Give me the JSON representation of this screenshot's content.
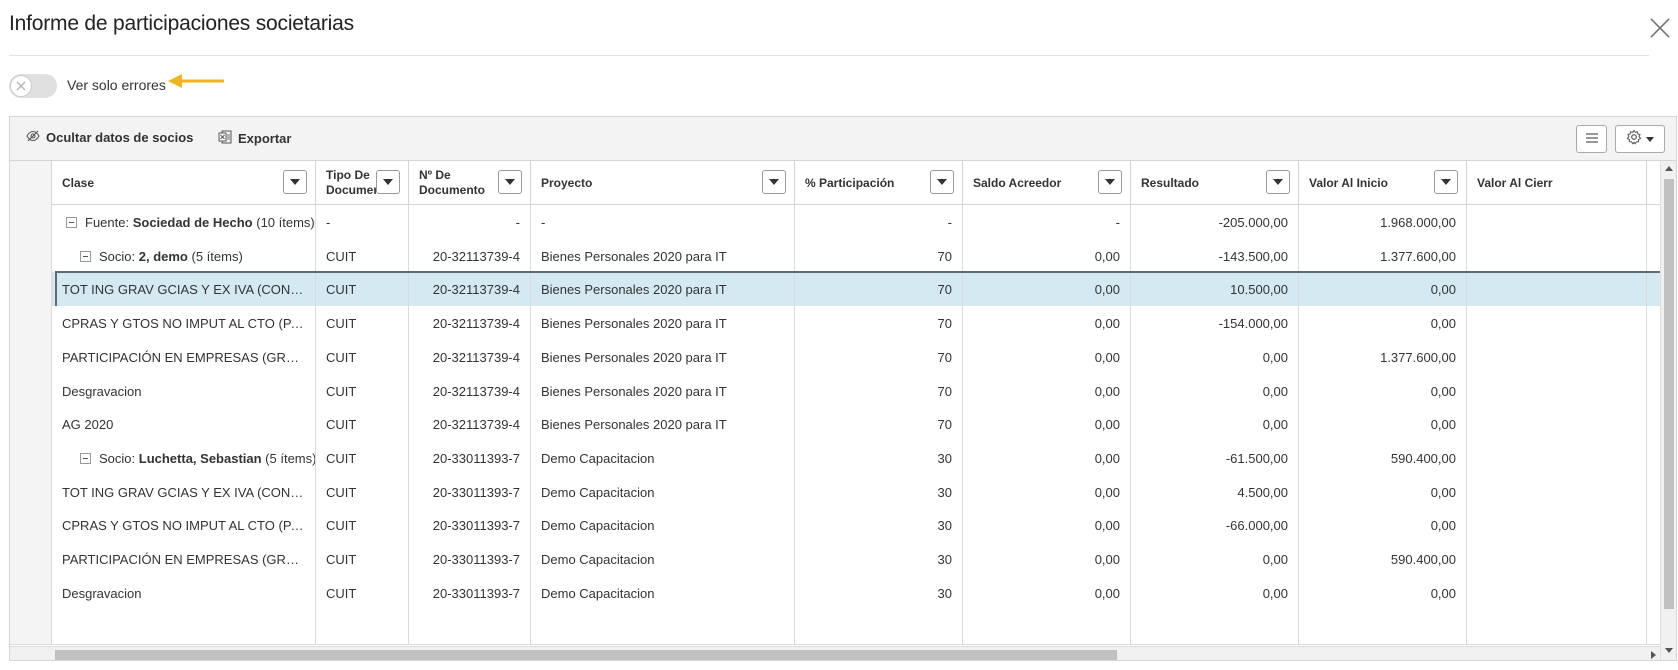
{
  "dialog": {
    "title": "Informe de participaciones societarias"
  },
  "filters": {
    "only_errors_label": "Ver solo errores",
    "only_errors_on": false
  },
  "toolbar": {
    "hide_partners_label": "Ocultar datos de socios",
    "export_label": "Exportar",
    "columns_menu_icon": "list-lines-icon",
    "settings_icon": "gear-icon"
  },
  "columns": [
    {
      "key": "clase",
      "label": "Clase"
    },
    {
      "key": "tipo",
      "label": "Tipo De Documento"
    },
    {
      "key": "nro",
      "label": "Nº De Documento"
    },
    {
      "key": "proyecto",
      "label": "Proyecto"
    },
    {
      "key": "participacion",
      "label": "% Participación"
    },
    {
      "key": "saldo",
      "label": "Saldo Acreedor"
    },
    {
      "key": "resultado",
      "label": "Resultado"
    },
    {
      "key": "valor_inicio",
      "label": "Valor Al Inicio"
    },
    {
      "key": "valor_cierre",
      "label": "Valor Al Cierr"
    }
  ],
  "rows": [
    {
      "kind": "group",
      "level": 0,
      "prefix": "Fuente: ",
      "name": "Sociedad de Hecho",
      "count": " (10 ítems)",
      "tipo": "-",
      "nro": "-",
      "proyecto": "-",
      "participacion": "-",
      "saldo": "-",
      "resultado": "-205.000,00",
      "valor_inicio": "1.968.000,00",
      "valor_cierre": ""
    },
    {
      "kind": "group",
      "level": 1,
      "prefix": "Socio: ",
      "name": "2, demo",
      "count": " (5 ítems)",
      "tipo": "CUIT",
      "nro": "20-32113739-4",
      "proyecto": "Bienes Personales 2020 para IT",
      "participacion": "70",
      "saldo": "0,00",
      "resultado": "-143.500,00",
      "valor_inicio": "1.377.600,00",
      "valor_cierre": ""
    },
    {
      "kind": "data",
      "selected": true,
      "clase": "TOT ING GRAV GCIAS Y EX IVA (CONT D...",
      "tipo": "CUIT",
      "nro": "20-32113739-4",
      "proyecto": "Bienes Personales 2020 para IT",
      "participacion": "70",
      "saldo": "0,00",
      "resultado": "10.500,00",
      "valor_inicio": "0,00",
      "valor_cierre": ""
    },
    {
      "kind": "data",
      "clase": "CPRAS Y GTOS NO IMPUT AL CTO (PAÍ...",
      "tipo": "CUIT",
      "nro": "20-32113739-4",
      "proyecto": "Bienes Personales 2020 para IT",
      "participacion": "70",
      "saldo": "0,00",
      "resultado": "-154.000,00",
      "valor_inicio": "0,00",
      "valor_cierre": ""
    },
    {
      "kind": "data",
      "clase": "PARTICIPACIÓN EN EMPRESAS (GRAVA...",
      "tipo": "CUIT",
      "nro": "20-32113739-4",
      "proyecto": "Bienes Personales 2020 para IT",
      "participacion": "70",
      "saldo": "0,00",
      "resultado": "0,00",
      "valor_inicio": "1.377.600,00",
      "valor_cierre": ""
    },
    {
      "kind": "data",
      "clase": "Desgravacion",
      "tipo": "CUIT",
      "nro": "20-32113739-4",
      "proyecto": "Bienes Personales 2020 para IT",
      "participacion": "70",
      "saldo": "0,00",
      "resultado": "0,00",
      "valor_inicio": "0,00",
      "valor_cierre": ""
    },
    {
      "kind": "data",
      "clase": "AG 2020",
      "tipo": "CUIT",
      "nro": "20-32113739-4",
      "proyecto": "Bienes Personales 2020 para IT",
      "participacion": "70",
      "saldo": "0,00",
      "resultado": "0,00",
      "valor_inicio": "0,00",
      "valor_cierre": ""
    },
    {
      "kind": "group",
      "level": 1,
      "prefix": "Socio: ",
      "name": "Luchetta, Sebastian",
      "count": " (5 ítems)",
      "tipo": "CUIT",
      "nro": "20-33011393-7",
      "proyecto": "Demo Capacitacion",
      "participacion": "30",
      "saldo": "0,00",
      "resultado": "-61.500,00",
      "valor_inicio": "590.400,00",
      "valor_cierre": ""
    },
    {
      "kind": "data",
      "clase": "TOT ING GRAV GCIAS Y EX IVA (CONT D...",
      "tipo": "CUIT",
      "nro": "20-33011393-7",
      "proyecto": "Demo Capacitacion",
      "participacion": "30",
      "saldo": "0,00",
      "resultado": "4.500,00",
      "valor_inicio": "0,00",
      "valor_cierre": ""
    },
    {
      "kind": "data",
      "clase": "CPRAS Y GTOS NO IMPUT AL CTO (PAÍ...",
      "tipo": "CUIT",
      "nro": "20-33011393-7",
      "proyecto": "Demo Capacitacion",
      "participacion": "30",
      "saldo": "0,00",
      "resultado": "-66.000,00",
      "valor_inicio": "0,00",
      "valor_cierre": ""
    },
    {
      "kind": "data",
      "clase": "PARTICIPACIÓN EN EMPRESAS (GRAVA...",
      "tipo": "CUIT",
      "nro": "20-33011393-7",
      "proyecto": "Demo Capacitacion",
      "participacion": "30",
      "saldo": "0,00",
      "resultado": "0,00",
      "valor_inicio": "590.400,00",
      "valor_cierre": ""
    },
    {
      "kind": "data",
      "clase": "Desgravacion",
      "tipo": "CUIT",
      "nro": "20-33011393-7",
      "proyecto": "Demo Capacitacion",
      "participacion": "30",
      "saldo": "0,00",
      "resultado": "0,00",
      "valor_inicio": "0,00",
      "valor_cierre": ""
    },
    {
      "kind": "data",
      "partial": true,
      "clase": "",
      "tipo": "",
      "nro": "",
      "proyecto": "",
      "participacion": "",
      "saldo": "",
      "resultado": "",
      "valor_inicio": "",
      "valor_cierre": ""
    }
  ],
  "annotations": {
    "arrow_color": "#f0b41c"
  },
  "colors": {
    "selected_row": "#d4e9f2",
    "header_bg": "#f3f3f3"
  }
}
